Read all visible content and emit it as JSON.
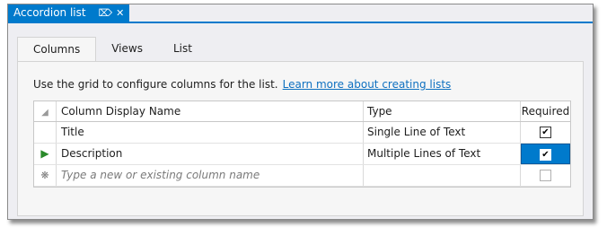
{
  "window": {
    "title": "Accordion list"
  },
  "tabs": [
    {
      "label": "Columns",
      "active": true
    },
    {
      "label": "Views",
      "active": false
    },
    {
      "label": "List",
      "active": false
    }
  ],
  "hint": {
    "text": "Use the grid to configure columns for the list.",
    "link": "Learn more about creating lists"
  },
  "grid": {
    "headers": {
      "name": "Column Display Name",
      "type": "Type",
      "required": "Required"
    },
    "rows": [
      {
        "name": "Title",
        "type": "Single Line of Text",
        "required": true,
        "current": false
      },
      {
        "name": "Description",
        "type": "Multiple Lines of Text",
        "required": true,
        "current": true
      }
    ],
    "new_row_placeholder": "Type a new or existing column name"
  },
  "colors": {
    "accent": "#007acc",
    "link": "#0e70c0",
    "row_indicator": "#2a8a2a"
  }
}
